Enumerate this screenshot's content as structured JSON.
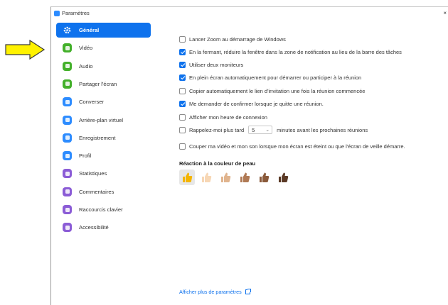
{
  "window": {
    "title": "Paramètres",
    "close": "×"
  },
  "sidebar": {
    "items": [
      {
        "label": "Général",
        "icon": "gear-icon",
        "color": "#0e72ed",
        "active": true
      },
      {
        "label": "Vidéo",
        "icon": "video-camera-icon",
        "color": "#43b02a"
      },
      {
        "label": "Audio",
        "icon": "headphones-icon",
        "color": "#43b02a"
      },
      {
        "label": "Partager l'écran",
        "icon": "share-screen-icon",
        "color": "#43b02a"
      },
      {
        "label": "Converser",
        "icon": "chat-icon",
        "color": "#2d8cff"
      },
      {
        "label": "Arrière-plan virtuel",
        "icon": "person-background-icon",
        "color": "#2d8cff"
      },
      {
        "label": "Enregistrement",
        "icon": "record-icon",
        "color": "#2d8cff"
      },
      {
        "label": "Profil",
        "icon": "profile-icon",
        "color": "#2d8cff"
      },
      {
        "label": "Statistiques",
        "icon": "statistics-icon",
        "color": "#8b5cd6"
      },
      {
        "label": "Commentaires",
        "icon": "feedback-icon",
        "color": "#8b5cd6"
      },
      {
        "label": "Raccourcis clavier",
        "icon": "keyboard-icon",
        "color": "#8b5cd6"
      },
      {
        "label": "Accessibilité",
        "icon": "accessibility-icon",
        "color": "#8b5cd6"
      }
    ]
  },
  "options": [
    {
      "label": "Lancer Zoom au démarrage de Windows",
      "checked": false
    },
    {
      "label": "En la fermant, réduire la fenêtre dans la zone de notification au lieu de la barre des tâches",
      "checked": true
    },
    {
      "label": "Utiliser deux moniteurs",
      "checked": true
    },
    {
      "label": "En plein écran automatiquement pour démarrer ou participer à la réunion",
      "checked": true
    },
    {
      "label": "Copier automatiquement le lien d'invitation une fois la réunion commencée",
      "checked": false
    },
    {
      "label": "Me demander de confirmer lorsque je quitte une réunion.",
      "checked": true
    },
    {
      "label": "Afficher mon heure de connexion",
      "checked": false
    },
    {
      "label_before": "Rappelez-moi plus tard",
      "select_value": "5",
      "label_after": "minutes avant les prochaines réunions",
      "checked": false
    },
    {
      "label": "Couper ma vidéo et mon son lorsque mon écran est éteint ou que l'écran de veille démarre.",
      "checked": false
    }
  ],
  "skin_tone": {
    "title": "Réaction à la couleur de peau",
    "tones": [
      "#f4b400",
      "#f7d7b5",
      "#e0b48e",
      "#b07a55",
      "#8a5a3b",
      "#5b3a26"
    ],
    "selected_index": 0
  },
  "footer": {
    "more_link": "Afficher plus de paramètres"
  },
  "annotation": {
    "arrow_color": "#fff200",
    "arrow_outline": "#3a3a3a"
  }
}
